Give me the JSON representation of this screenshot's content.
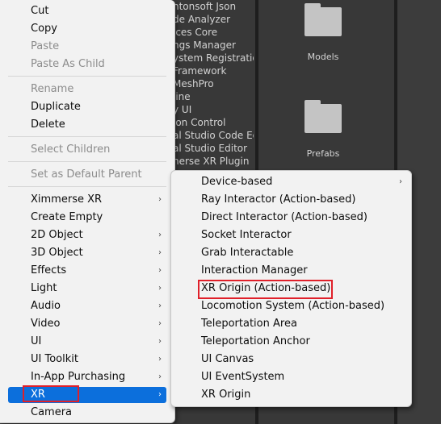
{
  "background": {
    "package_list": [
      "ntonsoft Json",
      "de Analyzer",
      "ices Core",
      "ngs Manager",
      "ystem Registration",
      "Framework",
      "MeshPro",
      "line",
      "y UI",
      "ion Control",
      "al Studio Code Edi",
      "al Studio Editor",
      "nerse XR Plugin"
    ],
    "assets": [
      {
        "label": "Models",
        "icon": "folder-icon"
      },
      {
        "label": "Prefabs",
        "icon": "folder-icon"
      }
    ]
  },
  "main_menu": {
    "items": [
      {
        "label": "Cut",
        "enabled": true
      },
      {
        "label": "Copy",
        "enabled": true
      },
      {
        "label": "Paste",
        "enabled": false
      },
      {
        "label": "Paste As Child",
        "enabled": false
      },
      {
        "label": "Rename",
        "enabled": false
      },
      {
        "label": "Duplicate",
        "enabled": true
      },
      {
        "label": "Delete",
        "enabled": true
      },
      {
        "label": "Select Children",
        "enabled": false
      },
      {
        "label": "Set as Default Parent",
        "enabled": false
      },
      {
        "label": "Ximmerse XR",
        "enabled": true,
        "submenu": true
      },
      {
        "label": "Create Empty",
        "enabled": true
      },
      {
        "label": "2D Object",
        "enabled": true,
        "submenu": true
      },
      {
        "label": "3D Object",
        "enabled": true,
        "submenu": true
      },
      {
        "label": "Effects",
        "enabled": true,
        "submenu": true
      },
      {
        "label": "Light",
        "enabled": true,
        "submenu": true
      },
      {
        "label": "Audio",
        "enabled": true,
        "submenu": true
      },
      {
        "label": "Video",
        "enabled": true,
        "submenu": true
      },
      {
        "label": "UI",
        "enabled": true,
        "submenu": true
      },
      {
        "label": "UI Toolkit",
        "enabled": true,
        "submenu": true
      },
      {
        "label": "In-App Purchasing",
        "enabled": true,
        "submenu": true
      },
      {
        "label": "XR",
        "enabled": true,
        "submenu": true,
        "selected": true
      },
      {
        "label": "Camera",
        "enabled": true
      }
    ],
    "submenu_arrow": "›"
  },
  "xr_submenu": {
    "items": [
      {
        "label": "Device-based",
        "submenu": true
      },
      {
        "label": "Ray Interactor (Action-based)"
      },
      {
        "label": "Direct Interactor (Action-based)"
      },
      {
        "label": "Socket Interactor"
      },
      {
        "label": "Grab Interactable"
      },
      {
        "label": "Interaction Manager"
      },
      {
        "label": "XR Origin (Action-based)",
        "highlighted": true
      },
      {
        "label": "Locomotion System (Action-based)"
      },
      {
        "label": "Teleportation Area"
      },
      {
        "label": "Teleportation Anchor"
      },
      {
        "label": "UI Canvas"
      },
      {
        "label": "UI EventSystem"
      },
      {
        "label": "XR Origin"
      }
    ]
  },
  "colors": {
    "selection": "#0c6fdc",
    "annotation_box": "#e0202a",
    "menu_bg": "#f2f2f2",
    "disabled_text": "#8c8c8c"
  }
}
